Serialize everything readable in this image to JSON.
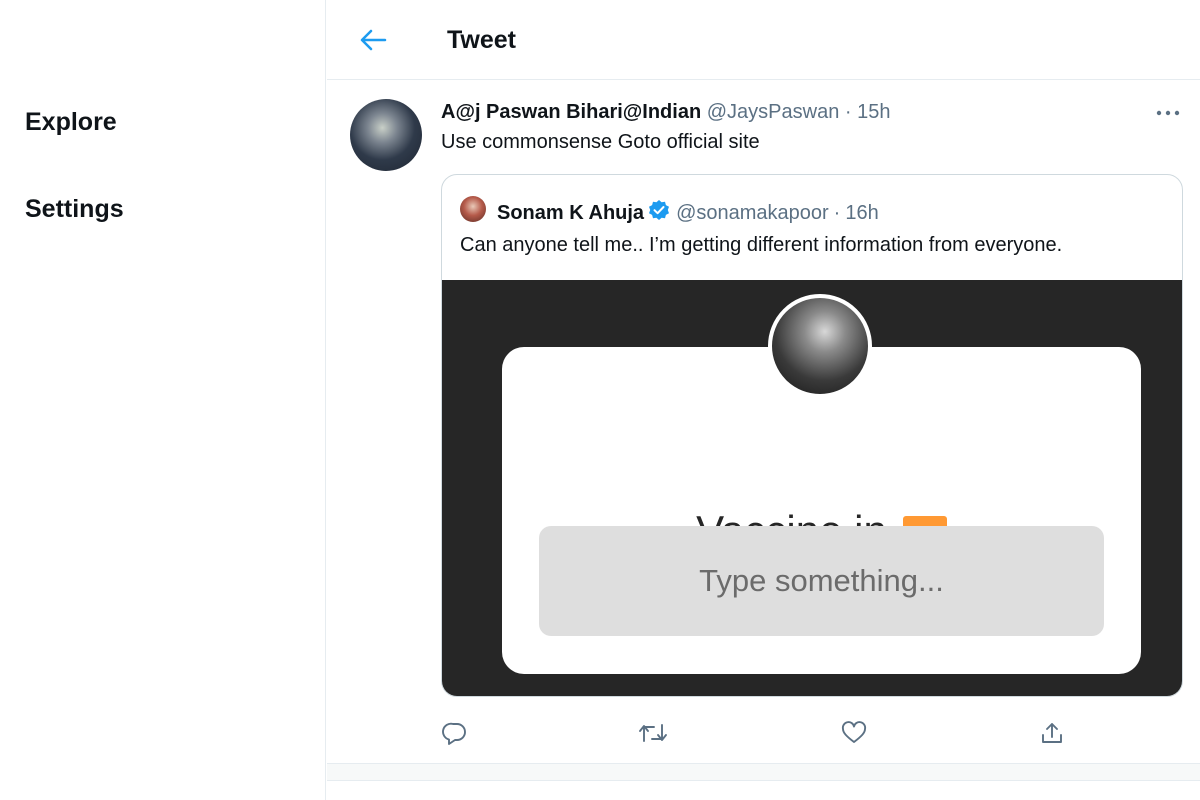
{
  "sidebar": {
    "items": [
      {
        "label": "Explore"
      },
      {
        "label": "Settings"
      }
    ]
  },
  "header": {
    "title": "Tweet",
    "back_icon": "arrow-left-icon"
  },
  "tweet": {
    "author_name": "A@j Paswan Bihari@Indian",
    "handle": "@JaysPaswan",
    "separator": "·",
    "time": "15h",
    "text": "Use commonsense Goto official site",
    "more_icon": "more-horizontal-icon",
    "quote": {
      "author_name": "Sonam K Ahuja",
      "verified": true,
      "handle": "@sonamakapoor",
      "separator": "·",
      "time": "16h",
      "text": "Can anyone tell me.. I’m getting different information from everyone.",
      "media": {
        "title": "Vaccine in",
        "flag_emoji": "india-flag",
        "input_placeholder": "Type something..."
      }
    },
    "actions": [
      {
        "icon": "reply-icon"
      },
      {
        "icon": "retweet-icon"
      },
      {
        "icon": "like-icon"
      },
      {
        "icon": "share-icon"
      }
    ]
  },
  "colors": {
    "accent": "#1d9bf0",
    "text": "#0f1419",
    "muted": "#5b7083",
    "border": "#cfd9de",
    "media_bg": "#262626"
  }
}
